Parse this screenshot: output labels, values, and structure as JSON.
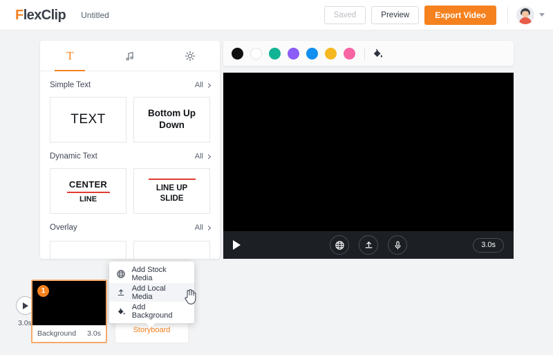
{
  "header": {
    "logo_f": "F",
    "logo_rest": "lexClip",
    "doc_title": "Untitled",
    "saved_label": "Saved",
    "preview_label": "Preview",
    "export_label": "Export Video"
  },
  "left_panel": {
    "tabs": [
      {
        "name": "text",
        "glyph": "T",
        "active": true
      },
      {
        "name": "music",
        "glyph": "♫",
        "active": false
      },
      {
        "name": "settings",
        "glyph": "⚙",
        "active": false
      }
    ],
    "sections": [
      {
        "title": "Simple Text",
        "all_label": "All",
        "cards": [
          {
            "kind": "plain",
            "text": "TEXT"
          },
          {
            "kind": "bold",
            "line1": "Bottom Up",
            "line2": "Down"
          }
        ]
      },
      {
        "title": "Dynamic Text",
        "all_label": "All",
        "cards": [
          {
            "kind": "center-line",
            "main": "CENTER",
            "sub": "LINE"
          },
          {
            "kind": "line-up",
            "line1": "LINE UP",
            "line2": "SLIDE"
          }
        ]
      },
      {
        "title": "Overlay",
        "all_label": "All",
        "cards": []
      }
    ]
  },
  "stage": {
    "colors": [
      {
        "name": "black",
        "hex": "#111111"
      },
      {
        "name": "white",
        "hex": "#ffffff"
      },
      {
        "name": "teal",
        "hex": "#10b394"
      },
      {
        "name": "purple",
        "hex": "#8b5cf6"
      },
      {
        "name": "blue",
        "hex": "#1190ef"
      },
      {
        "name": "amber",
        "hex": "#f5b820"
      },
      {
        "name": "pink",
        "hex": "#f765a3"
      }
    ],
    "fill_icon": "paint-bucket-icon",
    "player": {
      "play_icon": "play-icon",
      "tools": [
        "globe-icon",
        "upload-icon",
        "microphone-icon"
      ],
      "duration": "3.0s"
    }
  },
  "context_menu": {
    "items": [
      {
        "label": "Add Stock Media",
        "icon": "globe-icon",
        "hovered": false
      },
      {
        "label": "Add Local Media",
        "icon": "upload-icon",
        "hovered": true
      },
      {
        "label": "Add Background",
        "icon": "paint-bucket-icon",
        "hovered": false
      }
    ]
  },
  "timeline": {
    "play_duration": "3.0s",
    "clip": {
      "badge": "1",
      "name": "Background",
      "duration": "3.0s"
    },
    "add_card": {
      "label": "Storyboard"
    }
  },
  "theme": {
    "accent": "#f5821f",
    "panel_bg": "#f2f3f4"
  }
}
